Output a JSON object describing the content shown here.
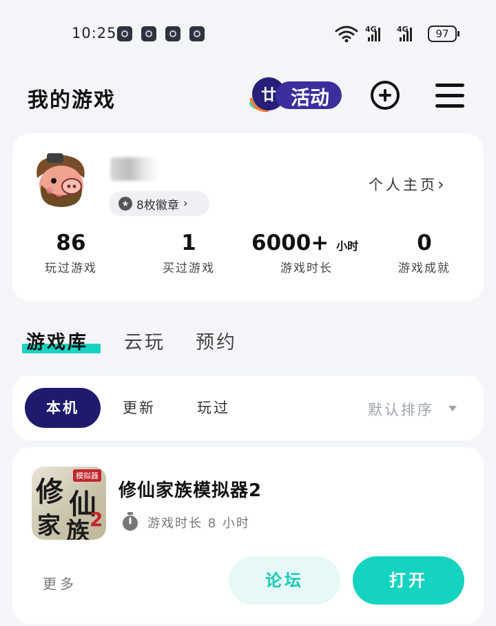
{
  "status_bar": {
    "time": "10:25",
    "network_1": "4G",
    "network_2": "4G",
    "battery": "97",
    "icons": [
      "notification-icon",
      "notification-icon",
      "notification-icon",
      "notification-icon",
      "wifi-icon",
      "signal-icon",
      "signal-icon",
      "battery-icon"
    ]
  },
  "header": {
    "title": "我的游戏",
    "activity_label": "活动"
  },
  "profile": {
    "badges_label": "8枚徽章",
    "homepage_link": "个人主页",
    "stats": [
      {
        "value": "86",
        "unit": "",
        "label": "玩过游戏"
      },
      {
        "value": "1",
        "unit": "",
        "label": "买过游戏"
      },
      {
        "value": "6000+",
        "unit": "小时",
        "label": "游戏时长"
      },
      {
        "value": "0",
        "unit": "",
        "label": "游戏成就"
      }
    ]
  },
  "tabs": [
    "游戏库",
    "云玩",
    "预约"
  ],
  "filters": {
    "chips": [
      "本机",
      "更新",
      "玩过"
    ],
    "sort_label": "默认排序"
  },
  "game": {
    "name": "修仙家族模拟器2",
    "icon_text_1": "修",
    "icon_text_2": "仙",
    "icon_text_3": "家",
    "icon_text_4": "族",
    "icon_tag": "模拟器",
    "icon_num": "2",
    "playtime": "游戏时长 8 小时",
    "more_label": "更多",
    "forum_label": "论坛",
    "open_label": "打开"
  },
  "colors": {
    "accent": "#15d3c1",
    "active_chip": "#1e1b6e",
    "background": "#f3f5f8"
  }
}
